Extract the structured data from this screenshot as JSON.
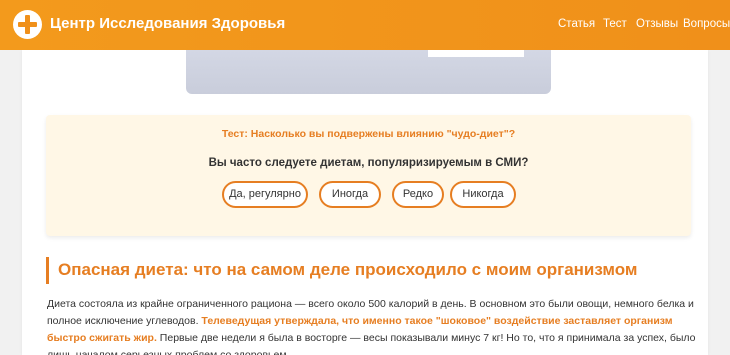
{
  "header": {
    "brand": "Центр Исследования Здоровья",
    "logo_icon": "plus-cross-icon",
    "nav": [
      "Статья",
      "Тест",
      "Отзывы",
      "Вопросы"
    ]
  },
  "quiz": {
    "title": "Тест: Насколько вы подвержены влиянию \"чудо-диет\"?",
    "question": "Вы часто следуете диетам, популяризируемым в СМИ?",
    "options": [
      "Да, регулярно",
      "Иногда",
      "Редко",
      "Никогда"
    ]
  },
  "article": {
    "heading": "Опасная диета: что на самом деле происходило с моим организмом",
    "para_start": "Диета состояла из крайне ограниченного рациона — всего около 500 калорий в день. В основном это были овощи, немного белка и полное исключение углеводов. ",
    "para_highlight": "Телеведущая утверждала, что именно такое \"шоковое\" воздействие заставляет организм быстро сжигать жир.",
    "para_end": " Первые две недели я была в восторге — весы показывали минус 7 кг! Но то, что я принимала за успех, было лишь началом серьезных проблем со здоровьем."
  },
  "colors": {
    "accent": "#e67e22",
    "header_bg": "#f39a1c",
    "quiz_bg": "#fff7e6"
  }
}
